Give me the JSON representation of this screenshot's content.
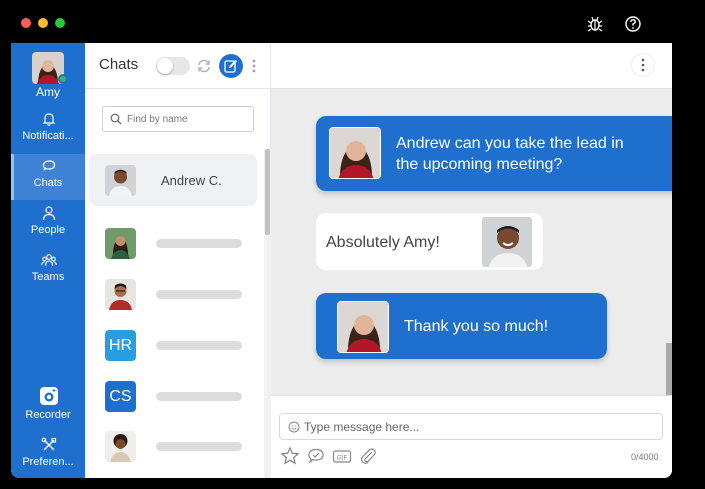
{
  "window": {
    "controls": [
      "close",
      "minimize",
      "maximize"
    ]
  },
  "titlebar_icons": [
    "bug-icon",
    "help-icon"
  ],
  "user": {
    "name": "Amy",
    "status": "online"
  },
  "nav": {
    "items": [
      {
        "label": "Notificati...",
        "icon": "bell-icon",
        "active": false
      },
      {
        "label": "Chats",
        "icon": "chat-bubble-icon",
        "active": true
      },
      {
        "label": "People",
        "icon": "person-icon",
        "active": false
      },
      {
        "label": "Teams",
        "icon": "team-icon",
        "active": false
      }
    ],
    "bottom": [
      {
        "label": "Recorder",
        "icon": "camera-icon"
      },
      {
        "label": "Preferen...",
        "icon": "tools-icon"
      }
    ]
  },
  "chat_list": {
    "title": "Chats",
    "search_placeholder": "Find by name",
    "rows": [
      {
        "name": "Andrew C.",
        "avatar": "photo-man-1",
        "selected": true
      },
      {
        "name": "",
        "avatar": "photo-woman-1"
      },
      {
        "name": "",
        "avatar": "photo-man-2"
      },
      {
        "name": "",
        "avatar_text": "HR",
        "avatar_color": "#2a9de0"
      },
      {
        "name": "",
        "avatar_text": "CS",
        "avatar_color": "#1f6fcf"
      },
      {
        "name": "",
        "avatar": "photo-woman-2"
      }
    ]
  },
  "conversation": {
    "messages": [
      {
        "from": "Amy",
        "direction": "out",
        "text_lines": [
          "Andrew can you take the lead in",
          "the upcoming meeting?"
        ]
      },
      {
        "from": "Andrew C.",
        "direction": "in",
        "text_lines": [
          "Absolutely Amy!"
        ]
      },
      {
        "from": "Amy",
        "direction": "out",
        "text_lines": [
          "Thank you so much!"
        ]
      }
    ],
    "composer": {
      "placeholder": "Type message here...",
      "counter": "0/4000",
      "tools": [
        "star-icon",
        "comment-icon",
        "gif-icon",
        "paperclip-icon"
      ]
    }
  },
  "colors": {
    "accent": "#1f6fcf",
    "online": "#2fbf4f",
    "hr_badge": "#2a9de0"
  }
}
